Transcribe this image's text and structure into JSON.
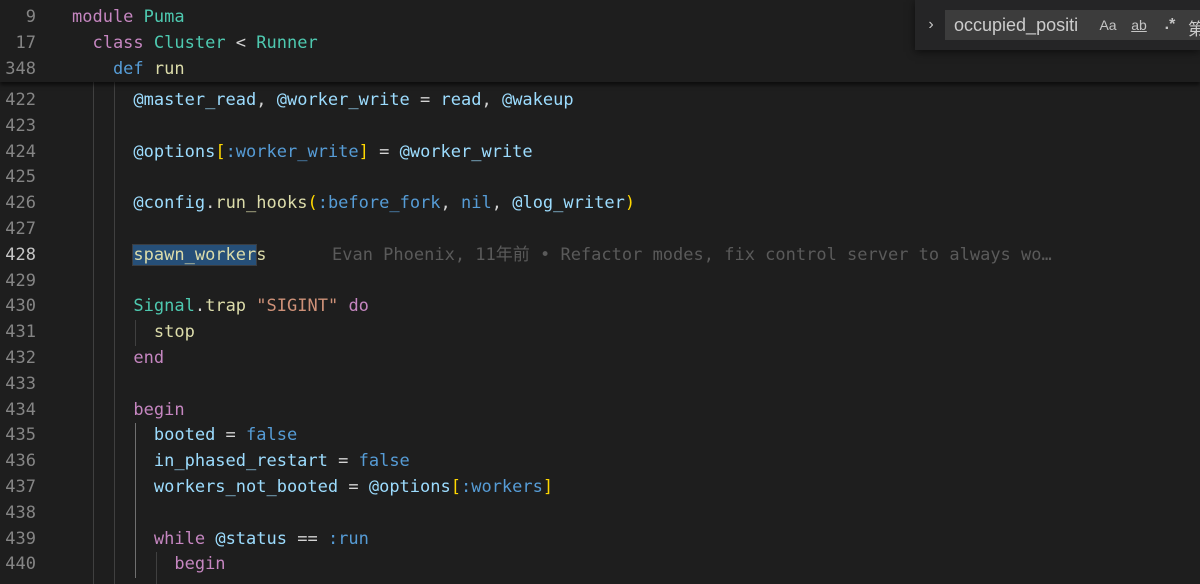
{
  "sticky_scroll": [
    {
      "line": "9",
      "tokens": [
        {
          "t": "module",
          "c": "kw"
        },
        {
          "t": " ",
          "c": "plain"
        },
        {
          "t": "Puma",
          "c": "cls"
        }
      ]
    },
    {
      "line": "17",
      "tokens": [
        {
          "t": "  class",
          "c": "kw"
        },
        {
          "t": " ",
          "c": "plain"
        },
        {
          "t": "Cluster",
          "c": "cls"
        },
        {
          "t": " < ",
          "c": "plain"
        },
        {
          "t": "Runner",
          "c": "cls"
        }
      ]
    },
    {
      "line": "348",
      "tokens": [
        {
          "t": "    def",
          "c": "def"
        },
        {
          "t": " ",
          "c": "plain"
        },
        {
          "t": "run",
          "c": "fn"
        }
      ]
    }
  ],
  "code_lines": [
    {
      "line": "422",
      "tokens": [
        {
          "t": "      ",
          "c": "plain"
        },
        {
          "t": "@master_read",
          "c": "ivar"
        },
        {
          "t": ", ",
          "c": "plain"
        },
        {
          "t": "@worker_write",
          "c": "ivar"
        },
        {
          "t": " = ",
          "c": "plain"
        },
        {
          "t": "read",
          "c": "var"
        },
        {
          "t": ", ",
          "c": "plain"
        },
        {
          "t": "@wakeup",
          "c": "ivar"
        }
      ]
    },
    {
      "line": "423",
      "tokens": []
    },
    {
      "line": "424",
      "tokens": [
        {
          "t": "      ",
          "c": "plain"
        },
        {
          "t": "@options",
          "c": "ivar"
        },
        {
          "t": "[",
          "c": "br1"
        },
        {
          "t": ":worker_write",
          "c": "sym"
        },
        {
          "t": "]",
          "c": "br1"
        },
        {
          "t": " = ",
          "c": "plain"
        },
        {
          "t": "@worker_write",
          "c": "ivar"
        }
      ]
    },
    {
      "line": "425",
      "tokens": []
    },
    {
      "line": "426",
      "tokens": [
        {
          "t": "      ",
          "c": "plain"
        },
        {
          "t": "@config",
          "c": "ivar"
        },
        {
          "t": ".",
          "c": "plain"
        },
        {
          "t": "run_hooks",
          "c": "fn"
        },
        {
          "t": "(",
          "c": "br1"
        },
        {
          "t": ":before_fork",
          "c": "sym"
        },
        {
          "t": ", ",
          "c": "plain"
        },
        {
          "t": "nil",
          "c": "const"
        },
        {
          "t": ", ",
          "c": "plain"
        },
        {
          "t": "@log_writer",
          "c": "ivar"
        },
        {
          "t": ")",
          "c": "br1"
        }
      ]
    },
    {
      "line": "427",
      "tokens": []
    },
    {
      "line": "428",
      "current": true,
      "tokens": [
        {
          "t": "      ",
          "c": "plain"
        },
        {
          "t": "spawn_worker",
          "c": "fn sel"
        },
        {
          "t": "s",
          "c": "fn"
        }
      ],
      "blame": "Evan Phoenix, 11年前 • Refactor modes, fix control server to always wo…"
    },
    {
      "line": "429",
      "tokens": []
    },
    {
      "line": "430",
      "tokens": [
        {
          "t": "      ",
          "c": "plain"
        },
        {
          "t": "Signal",
          "c": "cls"
        },
        {
          "t": ".",
          "c": "plain"
        },
        {
          "t": "trap",
          "c": "fn"
        },
        {
          "t": " ",
          "c": "plain"
        },
        {
          "t": "\"SIGINT\"",
          "c": "str"
        },
        {
          "t": " ",
          "c": "plain"
        },
        {
          "t": "do",
          "c": "ctrl"
        }
      ]
    },
    {
      "line": "431",
      "tokens": [
        {
          "t": "        ",
          "c": "plain"
        },
        {
          "t": "stop",
          "c": "fn"
        }
      ]
    },
    {
      "line": "432",
      "tokens": [
        {
          "t": "      ",
          "c": "plain"
        },
        {
          "t": "end",
          "c": "ctrl"
        }
      ]
    },
    {
      "line": "433",
      "tokens": []
    },
    {
      "line": "434",
      "tokens": [
        {
          "t": "      ",
          "c": "plain"
        },
        {
          "t": "begin",
          "c": "ctrl"
        }
      ]
    },
    {
      "line": "435",
      "tokens": [
        {
          "t": "        ",
          "c": "plain"
        },
        {
          "t": "booted",
          "c": "var"
        },
        {
          "t": " = ",
          "c": "plain"
        },
        {
          "t": "false",
          "c": "const"
        }
      ]
    },
    {
      "line": "436",
      "tokens": [
        {
          "t": "        ",
          "c": "plain"
        },
        {
          "t": "in_phased_restart",
          "c": "var"
        },
        {
          "t": " = ",
          "c": "plain"
        },
        {
          "t": "false",
          "c": "const"
        }
      ]
    },
    {
      "line": "437",
      "tokens": [
        {
          "t": "        ",
          "c": "plain"
        },
        {
          "t": "workers_not_booted",
          "c": "var"
        },
        {
          "t": " = ",
          "c": "plain"
        },
        {
          "t": "@options",
          "c": "ivar"
        },
        {
          "t": "[",
          "c": "br1"
        },
        {
          "t": ":workers",
          "c": "sym"
        },
        {
          "t": "]",
          "c": "br1"
        }
      ]
    },
    {
      "line": "438",
      "tokens": []
    },
    {
      "line": "439",
      "tokens": [
        {
          "t": "        ",
          "c": "plain"
        },
        {
          "t": "while",
          "c": "ctrl"
        },
        {
          "t": " ",
          "c": "plain"
        },
        {
          "t": "@status",
          "c": "ivar"
        },
        {
          "t": " == ",
          "c": "plain"
        },
        {
          "t": ":run",
          "c": "sym"
        }
      ]
    },
    {
      "line": "440",
      "tokens": [
        {
          "t": "          ",
          "c": "plain"
        },
        {
          "t": "begin",
          "c": "ctrl"
        }
      ]
    }
  ],
  "find_widget": {
    "toggle_icon": "›",
    "query": "occupied_positi",
    "match_case": "Aa",
    "whole_word": "ab",
    "regex": ".*",
    "overflow_text": "第"
  }
}
